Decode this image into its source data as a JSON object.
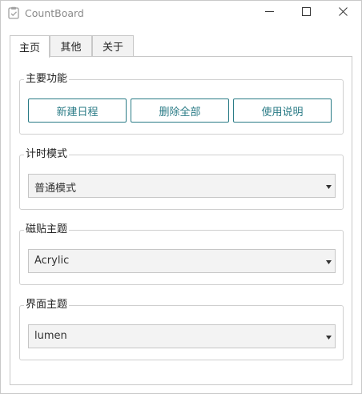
{
  "window": {
    "title": "CountBoard"
  },
  "tabs": [
    {
      "label": "主页"
    },
    {
      "label": "其他"
    },
    {
      "label": "关于"
    }
  ],
  "main_functions": {
    "label": "主要功能",
    "buttons": [
      {
        "label": "新建日程"
      },
      {
        "label": "删除全部"
      },
      {
        "label": "使用说明"
      }
    ]
  },
  "timer_mode": {
    "label": "计时模式",
    "value": "普通模式"
  },
  "tile_theme": {
    "label": "磁贴主题",
    "value": "Acrylic"
  },
  "ui_theme": {
    "label": "界面主题",
    "value": "lumen"
  },
  "colors": {
    "accent": "#2a7b86",
    "border": "#c8c8c8"
  }
}
